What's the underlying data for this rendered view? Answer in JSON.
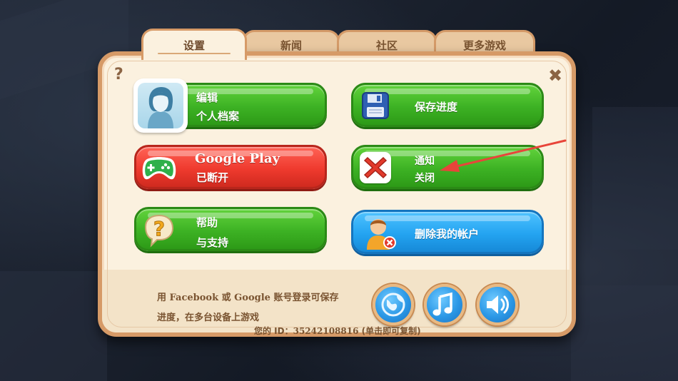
{
  "tabs": [
    {
      "label": "设置",
      "active": true
    },
    {
      "label": "新闻",
      "active": false
    },
    {
      "label": "社区",
      "active": false
    },
    {
      "label": "更多游戏",
      "active": false
    }
  ],
  "corner": {
    "help_icon": "question-mark-icon",
    "close_icon": "close-x-icon"
  },
  "buttons": {
    "profile": {
      "line1": "编辑",
      "line2": "个人档案",
      "icon": "avatar-icon",
      "color": "#3db224"
    },
    "save": {
      "line1": "保存进度",
      "icon": "floppy-disk-icon",
      "color": "#3db224"
    },
    "google_play": {
      "line1": "Google Play",
      "line2": "已断开",
      "icon": "gamepad-icon",
      "color": "#ef3a2e"
    },
    "notifications": {
      "line1": "通知",
      "line2": "关闭",
      "icon": "x-mark-icon",
      "color": "#3db224"
    },
    "help": {
      "line1": "帮助",
      "line2": "与支持",
      "icon": "question-bubble-icon",
      "color": "#3db224"
    },
    "delete_account": {
      "line1": "删除我的帐户",
      "icon": "user-delete-icon",
      "color": "#24a4f1"
    }
  },
  "footer": {
    "line1_pre": "用 ",
    "line1_fb": "Facebook",
    "line1_mid": " 或 ",
    "line1_google": "Google",
    "line1_post": " 账号登录可保存",
    "line2": "进度，在多台设备上游戏",
    "id_label": "您的 ID：",
    "id_value": "35242108816",
    "id_hint": " (单击即可复制)"
  },
  "circle_buttons": [
    {
      "icon": "globe-icon"
    },
    {
      "icon": "music-note-icon"
    },
    {
      "icon": "speaker-icon"
    }
  ],
  "colors": {
    "arrow": "#e8453a",
    "panel": "#fbf1df",
    "border": "#d69a67"
  }
}
